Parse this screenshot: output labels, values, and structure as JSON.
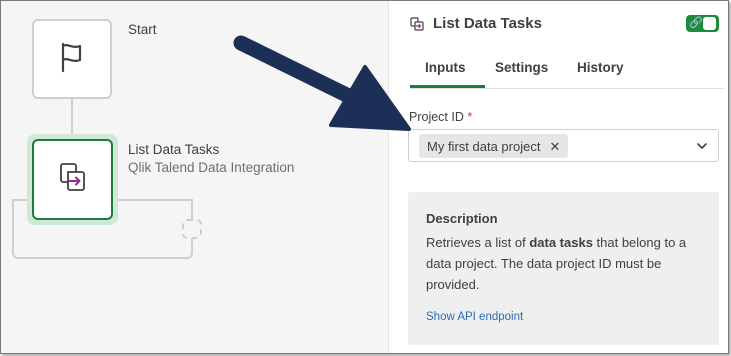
{
  "canvas": {
    "start_label": "Start",
    "task_label": "List Data Tasks",
    "task_sublabel": "Qlik Talend Data Integration",
    "icons": {
      "start": "flag-icon",
      "task": "data-task-icon",
      "connector": "loop-connector"
    }
  },
  "panel": {
    "title": "List Data Tasks",
    "title_icon": "data-task-icon",
    "toggle": {
      "state": "on",
      "icon": "link-icon"
    },
    "tabs": [
      {
        "label": "Inputs",
        "active": true
      },
      {
        "label": "Settings",
        "active": false
      },
      {
        "label": "History",
        "active": false
      }
    ],
    "project_field": {
      "label": "Project ID",
      "required_mark": "*",
      "selected_chip": "My first data project",
      "chip_remove_icon": "close-icon",
      "dropdown_icon": "chevron-down-icon"
    },
    "description": {
      "title": "Description",
      "text_before": "Retrieves a list of ",
      "text_bold": "data tasks",
      "text_after": " that belong to a data project. The data project ID must be provided.",
      "link": "Show API endpoint"
    }
  },
  "colors": {
    "accent_green": "#1e7a3c",
    "toggle_green": "#1e8a3a",
    "task_glow": "#cfe9d6",
    "arrow_navy": "#1c2f57",
    "link_blue": "#2a6db5",
    "required_red": "#c8372d",
    "task_icon_magenta": "#9b2c8a"
  }
}
